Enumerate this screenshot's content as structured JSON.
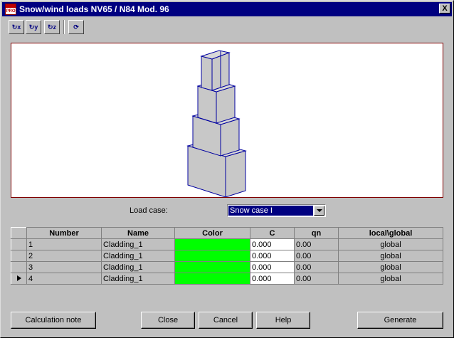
{
  "window": {
    "title": "Snow/wind loads NV65 / N84 Mod. 96",
    "app_icon_text": "PRO",
    "close_glyph": "X"
  },
  "toolbar": [
    {
      "name": "rotate-x-icon",
      "glyph": "↻x"
    },
    {
      "name": "rotate-y-icon",
      "glyph": "↻y"
    },
    {
      "name": "rotate-z-icon",
      "glyph": "↻z"
    },
    {
      "name": "refresh-icon",
      "glyph": "⟳"
    }
  ],
  "load_case": {
    "label": "Load case:",
    "selected": "Snow case I"
  },
  "table": {
    "headers": [
      "Number",
      "Name",
      "Color",
      "C",
      "qn",
      "local\\global"
    ],
    "rows": [
      {
        "number": "1",
        "name": "Cladding_1",
        "color": "#00ff00",
        "c": "0.000",
        "qn": "0.00",
        "local_global": "global",
        "active": false
      },
      {
        "number": "2",
        "name": "Cladding_1",
        "color": "#00ff00",
        "c": "0.000",
        "qn": "0.00",
        "local_global": "global",
        "active": false
      },
      {
        "number": "3",
        "name": "Cladding_1",
        "color": "#00ff00",
        "c": "0.000",
        "qn": "0.00",
        "local_global": "global",
        "active": false
      },
      {
        "number": "4",
        "name": "Cladding_1",
        "color": "#00ff00",
        "c": "0.000",
        "qn": "0.00",
        "local_global": "global",
        "active": true
      }
    ]
  },
  "buttons": {
    "calc_note": "Calculation note",
    "close": "Close",
    "cancel": "Cancel",
    "help": "Help",
    "generate": "Generate"
  }
}
